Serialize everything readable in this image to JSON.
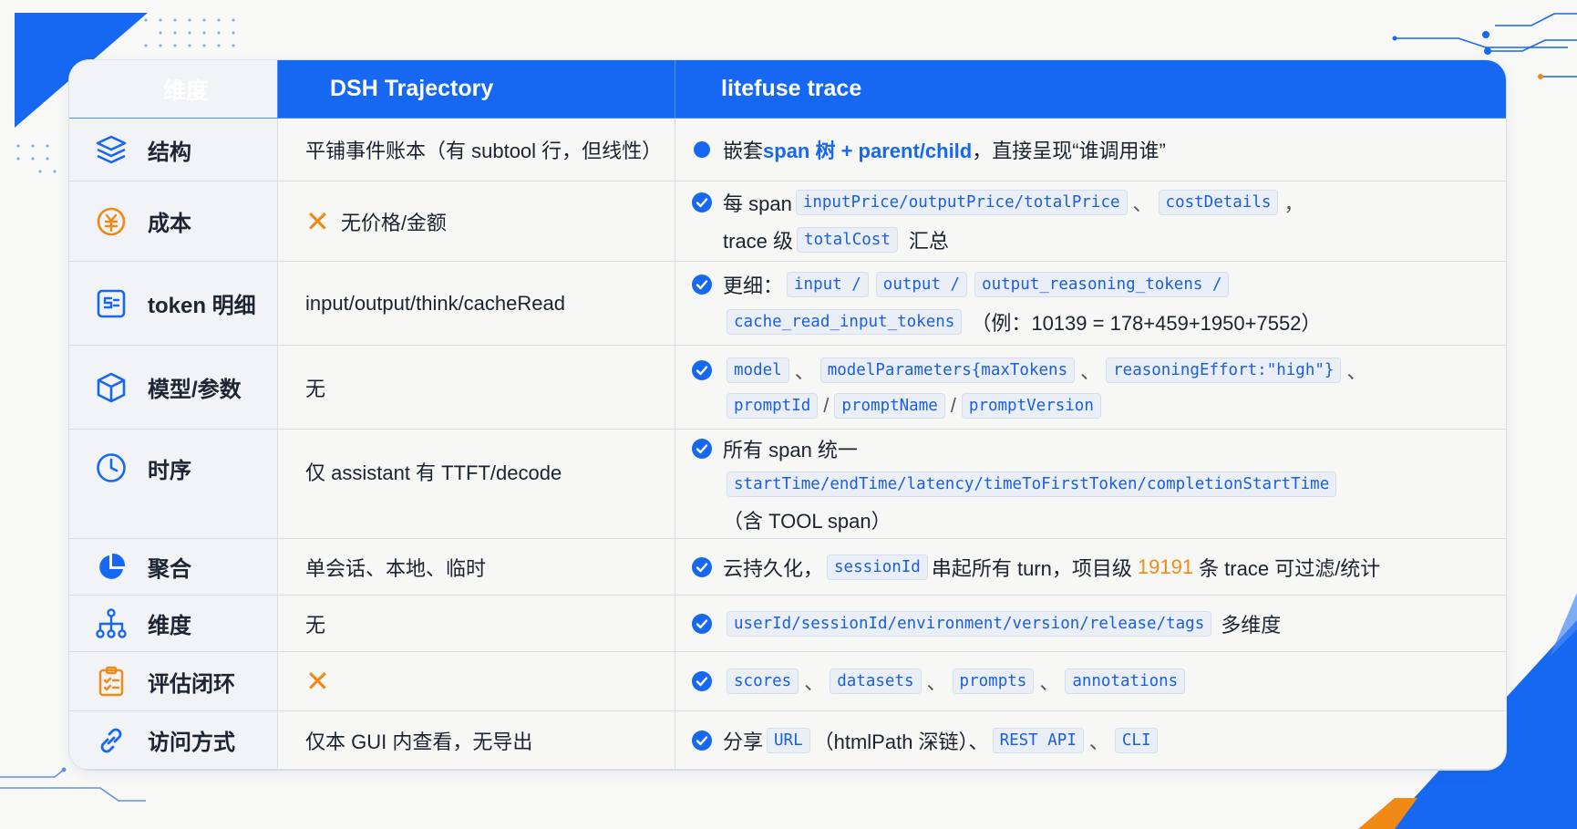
{
  "colors": {
    "accent": "#1668f2",
    "orange": "#f08a14"
  },
  "header": {
    "col1": "维度",
    "col2": "DSH Trajectory",
    "col3": "litefuse trace"
  },
  "rows": [
    {
      "icon": "layers-icon",
      "label": "结构",
      "dsh": "平铺事件账本（有 subtool 行，但线性）",
      "lf": {
        "pre": "嵌套 ",
        "blue": "span 树 + parent/child",
        "post": "，直接呈现“谁调用谁”"
      }
    },
    {
      "icon": "cost-coin-icon",
      "label": "成本",
      "dsh": "无价格/金额",
      "lf": {
        "t1": "每 span",
        "c1": "inputPrice/outputPrice/totalPrice",
        "s1": "、",
        "c2": "costDetails",
        "s2": "，",
        "t2": "trace 级",
        "c3": "totalCost",
        "t3": "汇总"
      }
    },
    {
      "icon": "token-chip-icon",
      "label": "token 明细",
      "dsh": "input/output/think/cacheRead",
      "lf": {
        "t1": "更细：",
        "c1": "input /",
        "c2": "output /",
        "c3": "output_reasoning_tokens /",
        "c4": "cache_read_input_tokens",
        "t2": "（例：10139 = 178+459+1950+7552）"
      }
    },
    {
      "icon": "cube-icon",
      "label": "模型/参数",
      "dsh": "无",
      "lf": {
        "c1": "model",
        "s1": "、",
        "c2": "modelParameters{maxTokens",
        "s2": "、",
        "c3": "reasoningEffort:\"high\"}",
        "s3": "、",
        "c4": "promptId",
        "s4": "/",
        "c5": "promptName",
        "s5": "/",
        "c6": "promptVersion"
      }
    },
    {
      "icon": "clock-icon",
      "label": "时序",
      "dsh": "仅 assistant 有 TTFT/decode",
      "lf": {
        "t1": "所有 span 统一",
        "c1": "startTime/endTime/latency/timeToFirstToken/completionStartTime",
        "t2": "（含 TOOL span）"
      }
    },
    {
      "icon": "pie-chart-icon",
      "label": "聚合",
      "dsh": "单会话、本地、临时",
      "lf": {
        "t1": "云持久化，",
        "c1": "sessionId",
        "t2": "串起所有 turn，项目级",
        "num": "19191",
        "t3": "条 trace 可过滤/统计"
      }
    },
    {
      "icon": "hierarchy-icon",
      "label": "维度",
      "dsh": "无",
      "lf": {
        "c1": "userId/sessionId/environment/version/release/tags",
        "t1": "多维度"
      }
    },
    {
      "icon": "clipboard-check-icon",
      "label": "评估闭环",
      "dsh": "",
      "lf": {
        "c1": "scores",
        "s1": "、",
        "c2": "datasets",
        "s2": "、",
        "c3": "prompts",
        "s3": "、",
        "c4": "annotations"
      }
    },
    {
      "icon": "link-icon",
      "label": "访问方式",
      "dsh": "仅本 GUI 内查看，无导出",
      "lf": {
        "t1": "分享",
        "c1": "URL",
        "t2": "（htmlPath 深链）、",
        "c2": "REST API",
        "s1": "、",
        "c3": "CLI"
      }
    }
  ]
}
